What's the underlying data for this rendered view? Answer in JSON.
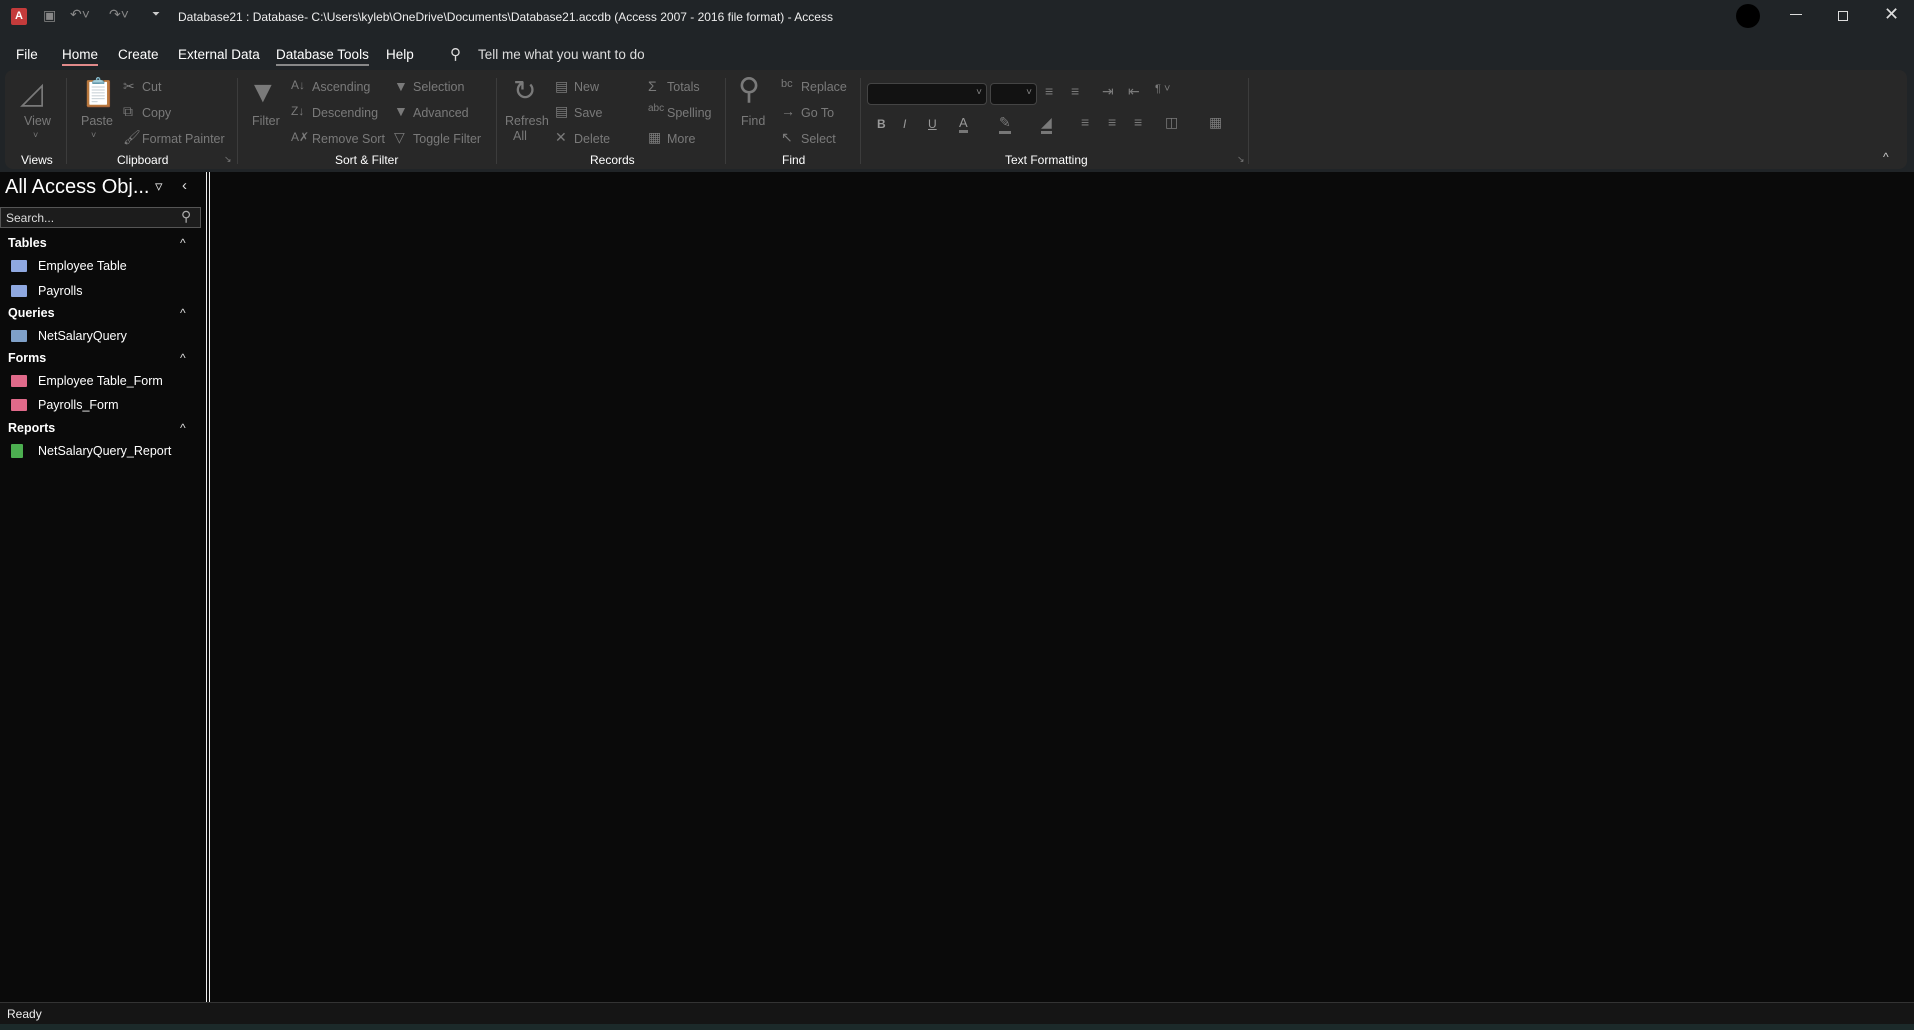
{
  "window": {
    "title": "Database21 : Database- C:\\Users\\kyleb\\OneDrive\\Documents\\Database21.accdb (Access 2007 - 2016 file format)  -  Access",
    "app_icon": "access-logo",
    "qat": [
      "save-icon",
      "undo-icon",
      "redo-icon",
      "customize-icon"
    ]
  },
  "menu": {
    "tabs": [
      "File",
      "Home",
      "Create",
      "External Data",
      "Database Tools",
      "Help"
    ],
    "active": "Home",
    "tell_me": "Tell me what you want to do"
  },
  "ribbon": {
    "views": {
      "view": "View",
      "label": "Views"
    },
    "clipboard": {
      "paste": "Paste",
      "cut": "Cut",
      "copy": "Copy",
      "format_painter": "Format Painter",
      "label": "Clipboard"
    },
    "sort_filter": {
      "filter": "Filter",
      "ascending": "Ascending",
      "descending": "Descending",
      "remove_sort": "Remove Sort",
      "selection": "Selection",
      "advanced": "Advanced",
      "toggle_filter": "Toggle Filter",
      "label": "Sort & Filter"
    },
    "records": {
      "refresh": "Refresh",
      "all": "All",
      "new": "New",
      "save": "Save",
      "delete": "Delete",
      "totals": "Totals",
      "spelling": "Spelling",
      "more": "More",
      "label": "Records"
    },
    "find": {
      "find": "Find",
      "replace": "Replace",
      "goto": "Go To",
      "select": "Select",
      "label": "Find"
    },
    "text_formatting": {
      "font": "",
      "size": "",
      "bold": "B",
      "italic": "I",
      "underline": "U",
      "font_color": "A",
      "label": "Text Formatting"
    }
  },
  "nav": {
    "title": "All Access Obj...",
    "search_placeholder": "Search...",
    "groups": [
      {
        "name": "Tables",
        "items": [
          "Employee Table",
          "Payrolls"
        ]
      },
      {
        "name": "Queries",
        "items": [
          "NetSalaryQuery"
        ]
      },
      {
        "name": "Forms",
        "items": [
          "Employee Table_Form",
          "Payrolls_Form"
        ]
      },
      {
        "name": "Reports",
        "items": [
          "NetSalaryQuery_Report"
        ]
      }
    ]
  },
  "status": {
    "text": "Ready"
  },
  "colors": {
    "accent": "#c04a4a",
    "titlebar": "#202427",
    "ribbon": "#282828",
    "table_icon": "#8fa8e0",
    "form_icon": "#e06a8a",
    "report_icon": "#4caf50"
  }
}
